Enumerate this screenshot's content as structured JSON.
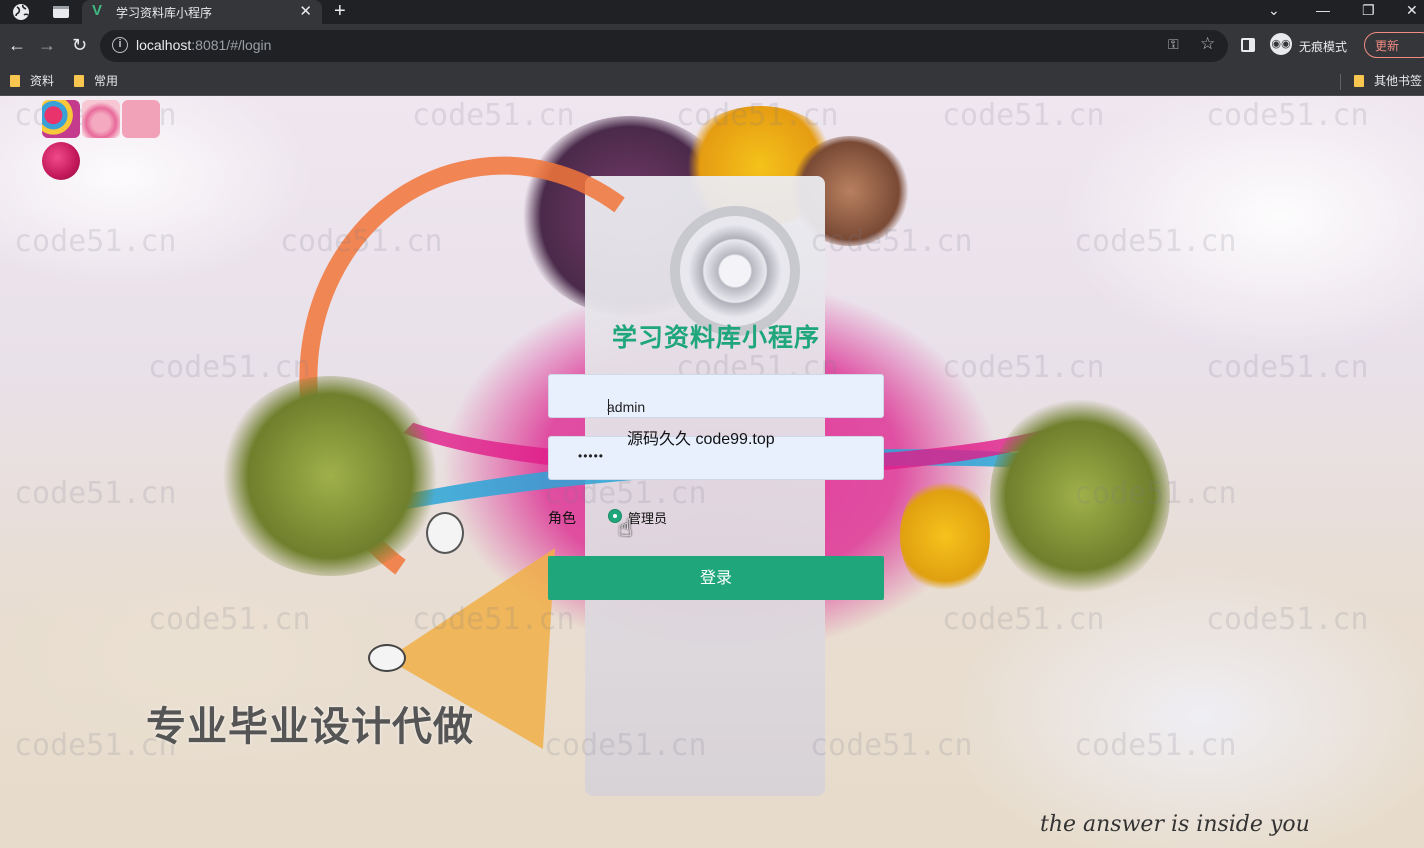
{
  "browser": {
    "tab_title": "学习资料库小程序",
    "url_host": "localhost",
    "url_rest": ":8081/#/login",
    "incognito_label": "无痕模式",
    "update_label": "更新",
    "bookmarks": [
      "资料",
      "常用"
    ],
    "other_bookmarks": "其他书签"
  },
  "login": {
    "title": "学习资料库小程序",
    "username_value": "admin",
    "password_mask": "•••••",
    "role_label": "角色",
    "role_option": "管理员",
    "submit_label": "登录"
  },
  "overlays": {
    "source_text": "源码久久 code99.top",
    "promo": "专业毕业设计代做",
    "tagline": "the answer is inside you",
    "watermark": "code51.cn"
  },
  "colors": {
    "accent": "#1fa67a",
    "chrome_dark": "#202124",
    "chrome_toolbar": "#35363a"
  }
}
